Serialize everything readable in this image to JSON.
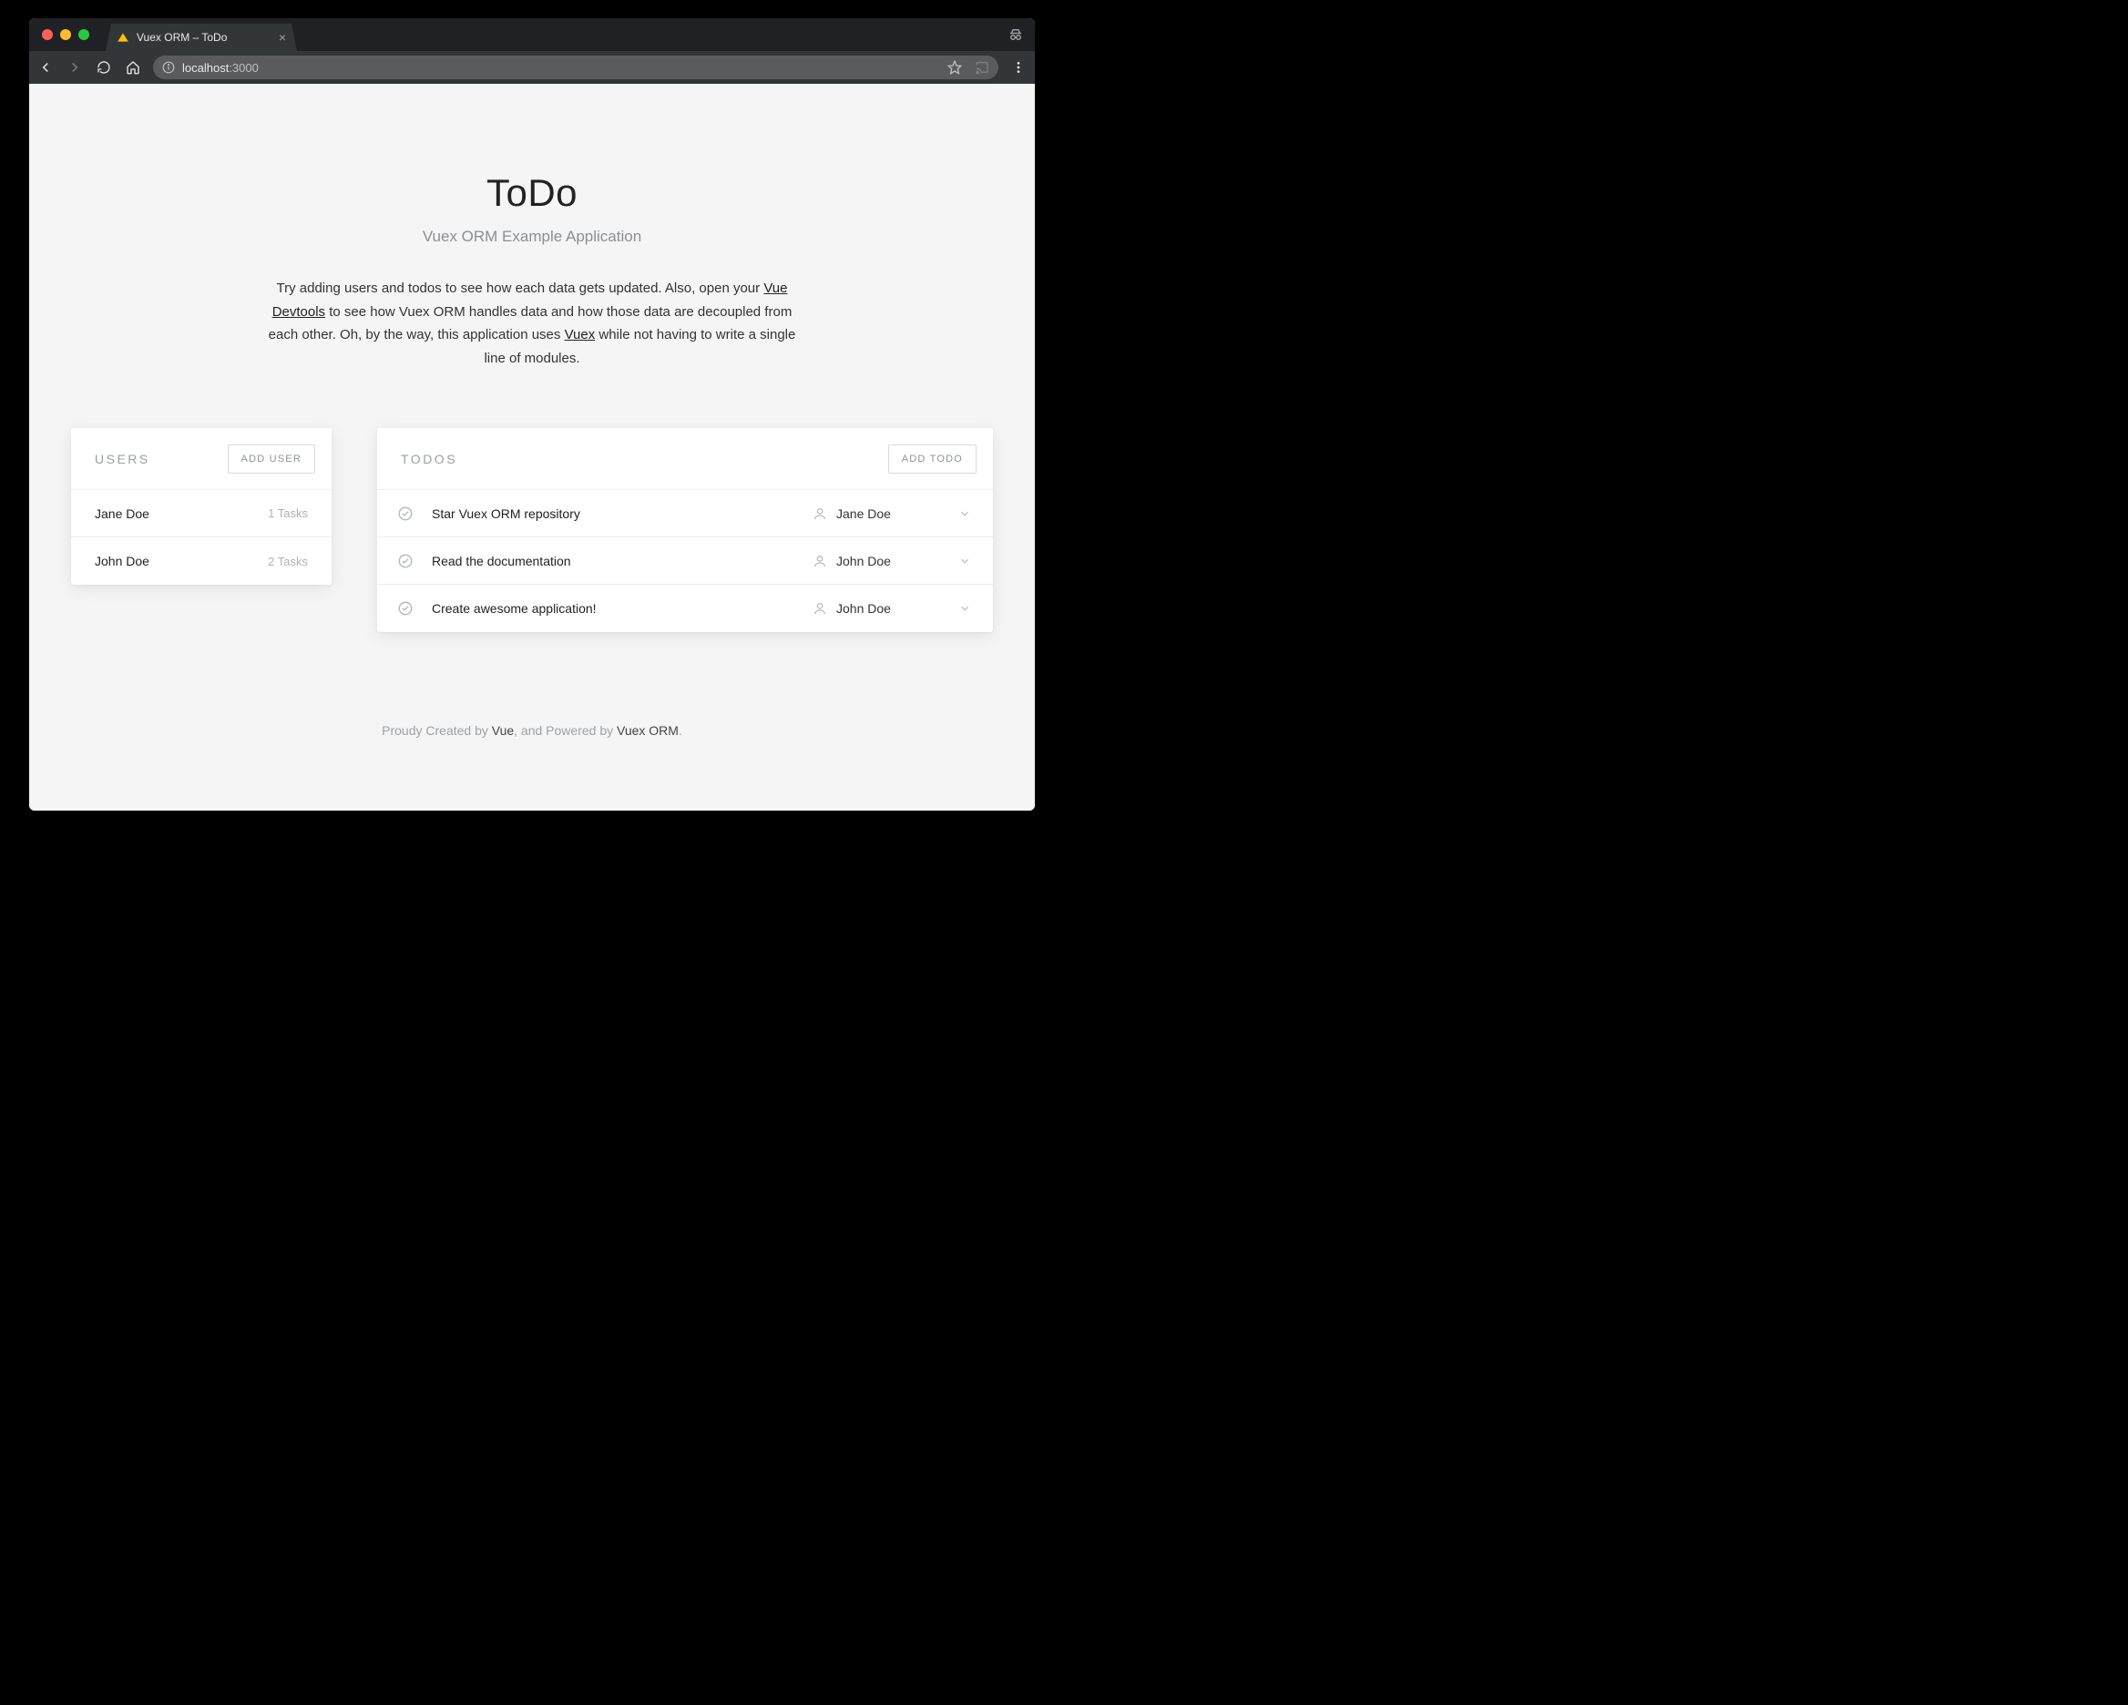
{
  "browser": {
    "tab_title": "Vuex ORM – ToDo",
    "url_host": "localhost",
    "url_port": ":3000"
  },
  "hero": {
    "title": "ToDo",
    "subtitle": "Vuex ORM Example Application",
    "desc_p1": "Try adding users and todos to see how each data gets updated. Also, open your ",
    "link1": "Vue Devtools",
    "desc_p2": " to see how Vuex ORM handles data and how those data are decoupled from each other. Oh, by the way, this application uses ",
    "link2": "Vuex",
    "desc_p3": " while not having to write a single line of modules."
  },
  "users": {
    "heading": "USERS",
    "add_label": "ADD USER",
    "list": [
      {
        "name": "Jane Doe",
        "meta": "1 Tasks"
      },
      {
        "name": "John Doe",
        "meta": "2 Tasks"
      }
    ]
  },
  "todos": {
    "heading": "TODOS",
    "add_label": "ADD TODO",
    "list": [
      {
        "title": "Star Vuex ORM repository",
        "assignee": "Jane Doe"
      },
      {
        "title": "Read the documentation",
        "assignee": "John Doe"
      },
      {
        "title": "Create awesome application!",
        "assignee": "John Doe"
      }
    ]
  },
  "footer": {
    "p1": "Proudy Created by ",
    "s1": "Vue",
    "p2": ", and Powered by ",
    "s2": "Vuex ORM",
    "p3": "."
  }
}
